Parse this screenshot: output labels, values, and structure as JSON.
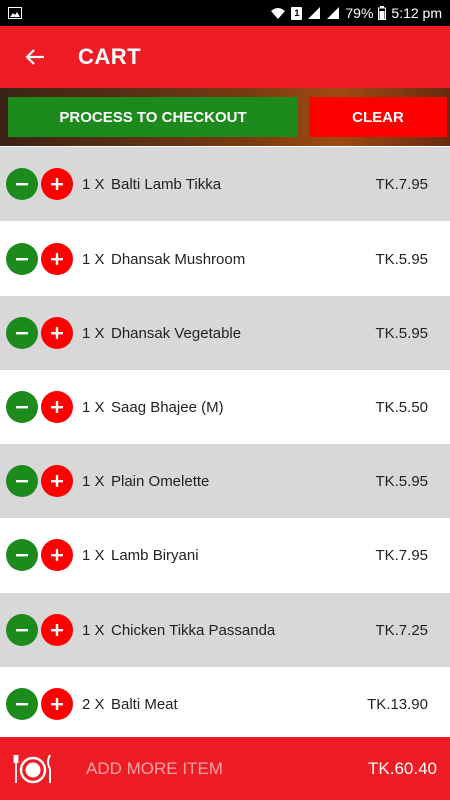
{
  "status_bar": {
    "sim_badge": "1",
    "battery": "79%",
    "time": "5:12 pm"
  },
  "header": {
    "title": "CART",
    "back_icon": "arrow-left-icon"
  },
  "actions": {
    "checkout_label": "PROCESS TO CHECKOUT",
    "clear_label": "CLEAR"
  },
  "cart": {
    "items": [
      {
        "qty": "1 X",
        "name": "Balti Lamb Tikka",
        "price": "TK.7.95"
      },
      {
        "qty": "1 X",
        "name": "Dhansak Mushroom",
        "price": "TK.5.95"
      },
      {
        "qty": "1 X",
        "name": "Dhansak Vegetable",
        "price": "TK.5.95"
      },
      {
        "qty": "1 X",
        "name": "Saag Bhajee (M)",
        "price": "TK.5.50"
      },
      {
        "qty": "1 X",
        "name": "Plain Omelette",
        "price": "TK.5.95"
      },
      {
        "qty": "1 X",
        "name": "Lamb Biryani",
        "price": "TK.7.95"
      },
      {
        "qty": "1 X",
        "name": "Chicken Tikka Passanda",
        "price": "TK.7.25"
      },
      {
        "qty": "2 X",
        "name": "Balti Meat",
        "price": "TK.13.90"
      }
    ]
  },
  "footer": {
    "add_more_label": "ADD MORE ITEM",
    "total": "TK.60.40",
    "icon": "plate-cutlery-icon"
  },
  "colors": {
    "primary_red": "#ee1c25",
    "minus_green": "#1d8a1d",
    "plus_red": "#ff0000",
    "row_gray": "#d8d8d8"
  }
}
